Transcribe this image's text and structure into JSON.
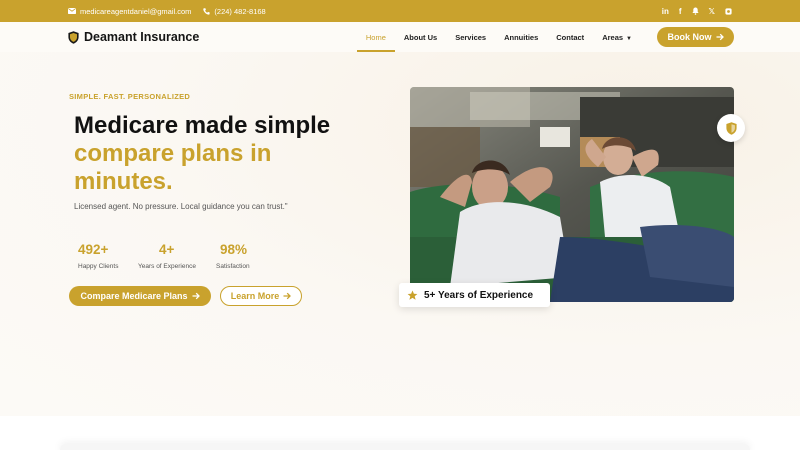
{
  "topbar": {
    "email": "medicareagentdaniel@gmail.com",
    "phone": "(224) 482-8168",
    "social": [
      "linkedin-icon",
      "facebook-icon",
      "bell-icon",
      "x-icon",
      "instagram-icon"
    ]
  },
  "brand": {
    "name": "Deamant Insurance"
  },
  "nav": {
    "items": [
      {
        "label": "Home",
        "active": true
      },
      {
        "label": "About Us"
      },
      {
        "label": "Services"
      },
      {
        "label": "Annuities"
      },
      {
        "label": "Contact"
      },
      {
        "label": "Areas",
        "dropdown": true
      }
    ],
    "book_label": "Book Now"
  },
  "hero": {
    "eyebrow": "SIMPLE. FAST. PERSONALIZED",
    "headline_line1": "Medicare made simple",
    "headline_line2": "compare plans in minutes.",
    "lead": "Licensed agent. No pressure. Local guidance you can trust.\"",
    "stats": [
      {
        "value": "492+",
        "label": "Happy Clients"
      },
      {
        "value": "4+",
        "label": "Years of Experience"
      },
      {
        "value": "98%",
        "label": "Satisfaction"
      }
    ],
    "cta_primary": "Compare Medicare Plans",
    "cta_secondary": "Learn More",
    "experience_badge": "5+ Years of Experience"
  },
  "colors": {
    "accent": "#c9a22d",
    "text": "#111111",
    "background": "#fbf8f3"
  }
}
